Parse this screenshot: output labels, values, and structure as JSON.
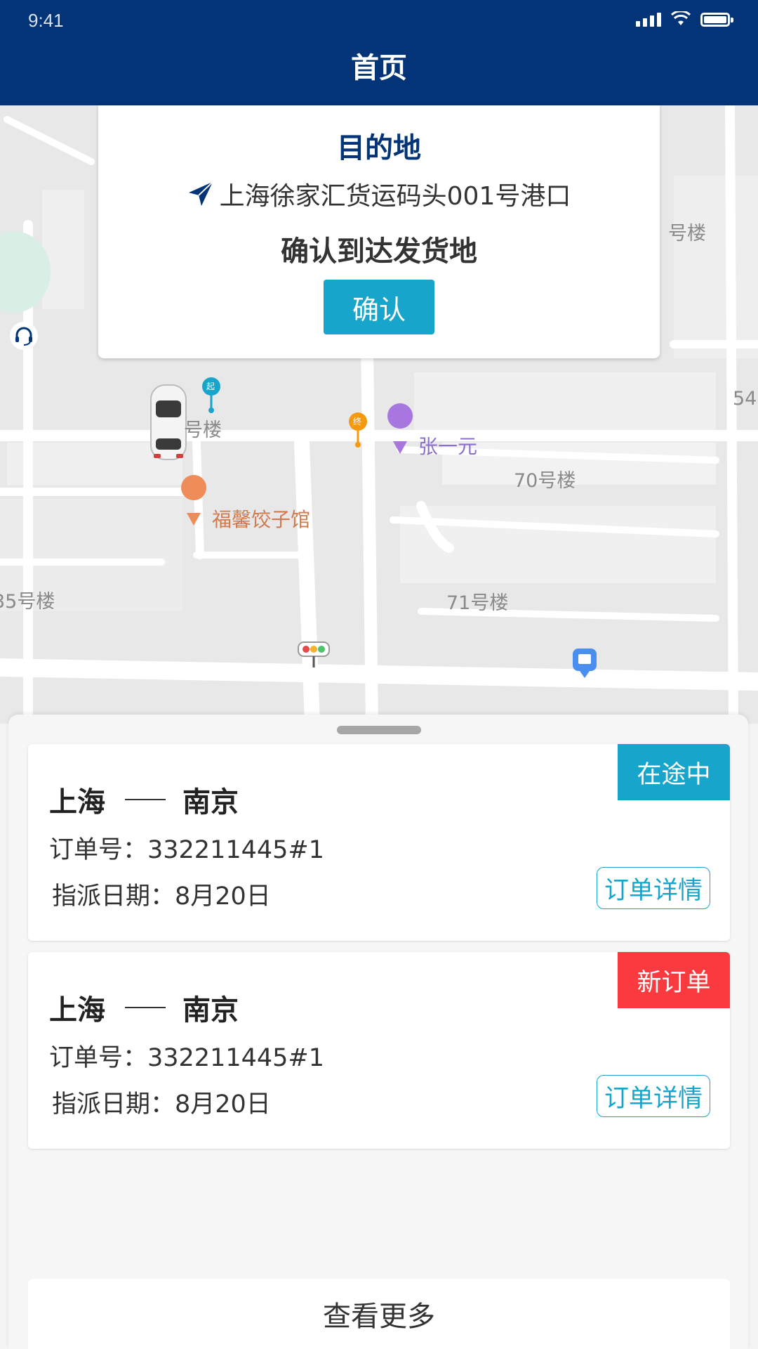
{
  "status_bar": {
    "time": "9:41"
  },
  "header": {
    "title": "首页"
  },
  "map": {
    "labels": {
      "building_a": "号楼",
      "building_b": "70号楼",
      "building_c": "71号楼",
      "building_d": "35号楼",
      "building_e": "号楼",
      "building_f": "54",
      "poi_restaurant": "福馨饺子馆",
      "poi_shop": "张一元",
      "start_marker": "起",
      "end_marker": "终"
    }
  },
  "destination_card": {
    "title": "目的地",
    "address": "上海徐家汇货运码头001号港口",
    "prompt": "确认到达发货地",
    "confirm_label": "确认"
  },
  "orders": [
    {
      "from": "上海",
      "to": "南京",
      "order_no": "订单号：332211445#1",
      "date": "指派日期：8月20日",
      "status": "在途中",
      "status_color": "#17a5cb",
      "detail_label": "订单详情"
    },
    {
      "from": "上海",
      "to": "南京",
      "order_no": "订单号：332211445#1",
      "date": "指派日期：8月20日",
      "status": "新订单",
      "status_color": "#fb3a3f",
      "detail_label": "订单详情"
    }
  ],
  "more_label": "查看更多",
  "colors": {
    "brand": "#033478",
    "accent": "#17a5cb",
    "alert": "#fb3a3f"
  }
}
